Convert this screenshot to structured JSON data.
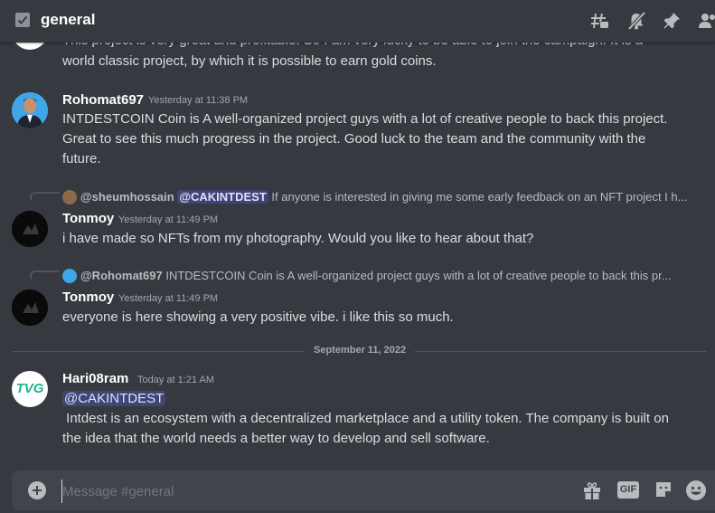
{
  "header": {
    "channel_name": "general",
    "icons": [
      "channel-icon",
      "threads-icon",
      "mute-bell-icon",
      "pin-icon",
      "members-icon"
    ]
  },
  "messages": [
    {
      "partial_text": "world classic project, by which it is possible to earn gold coins."
    },
    {
      "username": "Rohomat697",
      "timestamp": "Yesterday at 11:38 PM",
      "lines": [
        "INTDESTCOIN  Coin is A well-organized project guys with a lot of creative people to back this project.",
        "Great to see this much progress in the project. Good luck to the team and the community with the",
        "future."
      ]
    },
    {
      "reply": {
        "username": "@sheumhossain",
        "mention": "@CAKINTDEST",
        "text": "If anyone is interested in giving me some early feedback on an NFT project I h..."
      },
      "username": "Tonmoy",
      "timestamp": "Yesterday at 11:49 PM",
      "lines": [
        "i have made so NFTs from my photography. Would you like to hear about that?"
      ]
    },
    {
      "reply": {
        "username": "@Rohomat697",
        "text": "INTDESTCOIN  Coin is A well-organized project guys with a lot of creative people to back this pr..."
      },
      "username": "Tonmoy",
      "timestamp": "Yesterday at 11:49 PM",
      "lines": [
        "everyone is here showing a very positive vibe. i like this so much."
      ]
    },
    {
      "username": "Hari08ram",
      "timestamp": "Today at 1:21 AM",
      "mention": "@CAKINTDEST",
      "lines": [
        " Intdest is an ecosystem with a decentralized marketplace and a utility token. The company is built on",
        "the idea that the world needs a better way to develop and sell software."
      ]
    }
  ],
  "date_divider": "September 11, 2022",
  "avatars": {
    "hari_logo_text": "TVG"
  },
  "composer": {
    "placeholder": "Message #general",
    "icons": [
      "add-icon",
      "gift-icon",
      "gif-icon",
      "sticker-icon",
      "emoji-icon"
    ],
    "gif_label": "GIF"
  },
  "colors": {
    "background": "#36393f",
    "composer": "#40444b",
    "mention_bg": "#5865f24d",
    "tvg_green": "#1db58f"
  }
}
